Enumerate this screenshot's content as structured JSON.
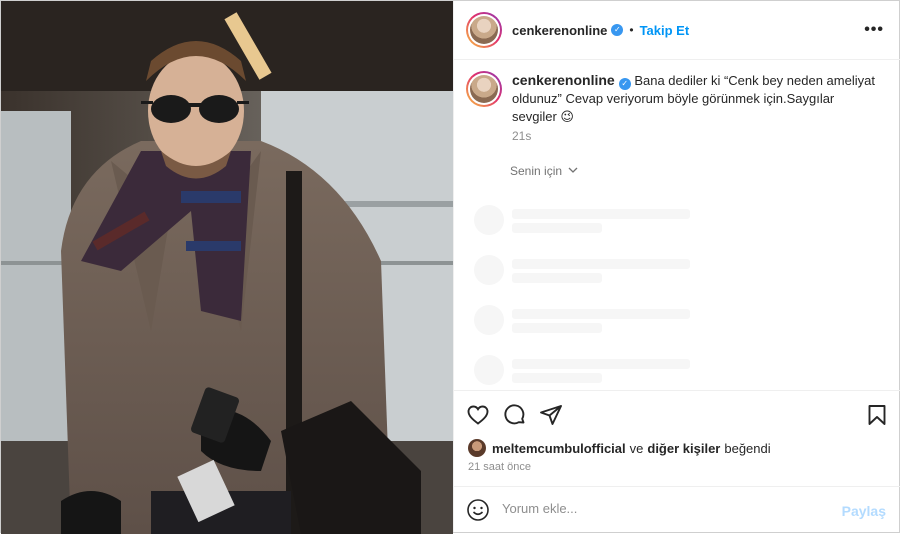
{
  "post": {
    "username": "cenkerenonline",
    "follow_label": "Takip Et",
    "more_label": "•••"
  },
  "caption": {
    "username": "cenkerenonline",
    "text": "Bana dediler ki “Cenk bey neden ameliyat oldunuz” Cevap veriyorum böyle görünmek için.Saygılar sevgiler 😉",
    "time": "21s",
    "sort_label": "Senin için"
  },
  "likes": {
    "first_user": "meltemcumbulofficial",
    "connector": "ve",
    "others": "diğer kişiler",
    "suffix": "beğendi"
  },
  "time_ago": "21 saat önce",
  "comment": {
    "placeholder": "Yorum ekle...",
    "share_label": "Paylaş"
  },
  "icons": [
    "heart-icon",
    "comment-icon",
    "share-icon",
    "bookmark-icon",
    "emoji-icon",
    "verified-icon",
    "chevron-down-icon"
  ],
  "colors": {
    "accent": "#0095f6",
    "share_disabled": "#b3dbff",
    "verified": "#3897f0"
  }
}
